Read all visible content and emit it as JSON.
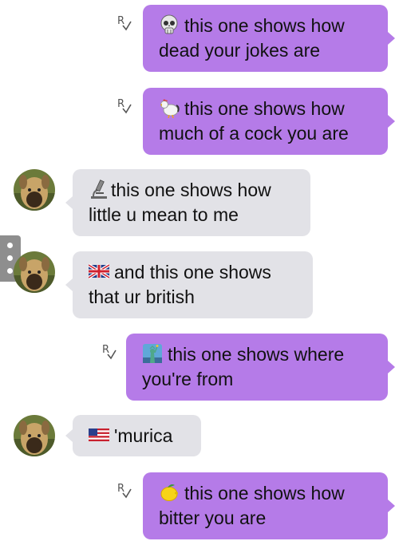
{
  "conversation": {
    "messages": [
      {
        "direction": "outgoing",
        "emoji": "skull-emoji",
        "lines": [
          "this one shows how",
          "dead your jokes are"
        ]
      },
      {
        "direction": "outgoing",
        "emoji": "rooster-emoji",
        "lines": [
          "this one shows how",
          "much of a cock you are"
        ]
      },
      {
        "direction": "incoming",
        "emoji": "microscope-emoji",
        "lines": [
          "this one shows how",
          "little u mean to me"
        ]
      },
      {
        "direction": "incoming",
        "emoji": "uk-flag-emoji",
        "lines": [
          "and this one shows",
          "that ur british"
        ]
      },
      {
        "direction": "outgoing",
        "emoji": "statue-of-liberty-emoji",
        "lines": [
          "this one shows where",
          "you're from"
        ]
      },
      {
        "direction": "incoming",
        "emoji": "us-flag-emoji",
        "lines": [
          "'murica"
        ]
      },
      {
        "direction": "outgoing",
        "emoji": "lemon-emoji",
        "lines": [
          "this one shows how",
          "bitter you are"
        ]
      }
    ]
  },
  "colors": {
    "outgoing_bubble": "#b57be8",
    "incoming_bubble": "#e2e2e7",
    "text": "#111111",
    "receipt_icon": "#555555",
    "side_handle": "#8e8e8e"
  },
  "icons": {
    "read_receipt": "read-receipt-icon",
    "avatar": "contact-avatar",
    "side_handle": "more-options-handle"
  }
}
